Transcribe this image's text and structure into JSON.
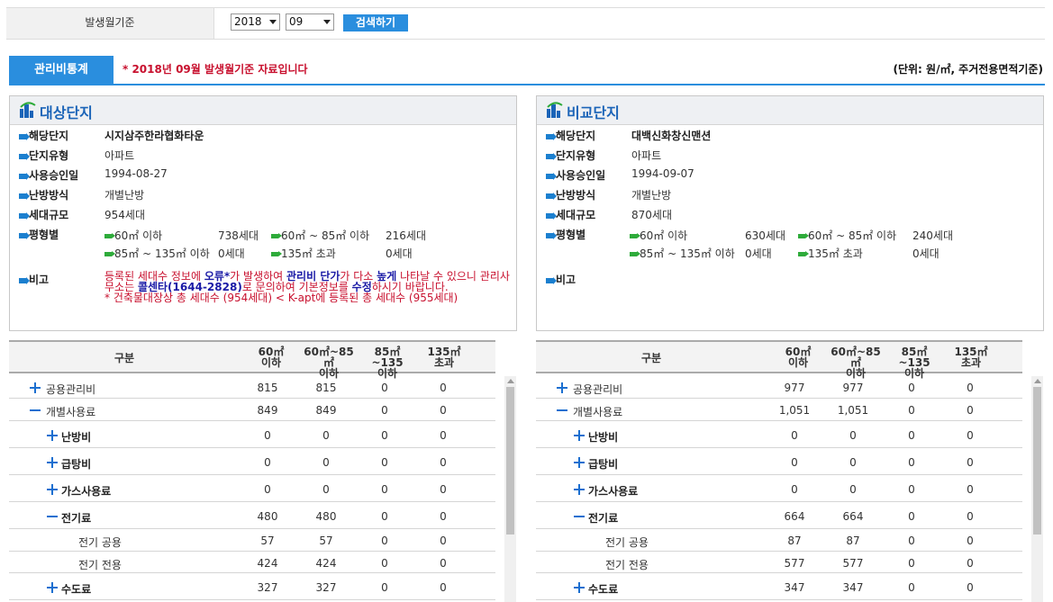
{
  "filter": {
    "label": "발생월기준",
    "year": "2018",
    "month": "09",
    "search_label": "검색하기"
  },
  "tab_label": "관리비통계",
  "notice": "* 2018년 09월 발생월기준 자료입니다",
  "unit": "(단위: 원/㎡, 주거전용면적기준)",
  "target": {
    "title": "대상단지",
    "labels": {
      "name": "해당단지",
      "type": "단지유형",
      "approval": "사용승인일",
      "heating": "난방방식",
      "households": "세대규모",
      "sizes": "평형별",
      "remarks": "비고"
    },
    "name": "시지삼주한라협화타운",
    "type": "아파트",
    "approval": "1994-08-27",
    "heating": "개별난방",
    "households": "954세대",
    "sizes": [
      {
        "label": "60㎡ 이하",
        "value": "738세대"
      },
      {
        "label": "60㎡ ~ 85㎡ 이하",
        "value": "216세대"
      },
      {
        "label": "85㎡ ~ 135㎡ 이하",
        "value": "0세대"
      },
      {
        "label": "135㎡ 초과",
        "value": "0세대"
      }
    ],
    "remarks": {
      "p1": "등록된 세대수 정보에 ",
      "p2": "오류*",
      "p3": "가 발생하여 ",
      "p4": "관리비 단가",
      "p5": "가 다소 ",
      "p6": "높게",
      "p7": " 나타날 수 있으니 관리사무소는 ",
      "p8": "콜센타(1644-2828)",
      "p9": "로 문의하여 기본정보를 ",
      "p10": "수정",
      "p11": "하시기 바랍니다.",
      "p12": "* 건축물대장상 총 세대수 (954세대) < K-apt에 등록된 총 세대수 (955세대)"
    }
  },
  "compare": {
    "title": "비교단지",
    "labels": {
      "name": "해당단지",
      "type": "단지유형",
      "approval": "사용승인일",
      "heating": "난방방식",
      "households": "세대규모",
      "sizes": "평형별",
      "remarks": "비고"
    },
    "name": "대백신화창신맨션",
    "type": "아파트",
    "approval": "1994-09-07",
    "heating": "개별난방",
    "households": "870세대",
    "sizes": [
      {
        "label": "60㎡ 이하",
        "value": "630세대"
      },
      {
        "label": "60㎡ ~ 85㎡ 이하",
        "value": "240세대"
      },
      {
        "label": "85㎡ ~ 135㎡ 이하",
        "value": "0세대"
      },
      {
        "label": "135㎡ 초과",
        "value": "0세대"
      }
    ]
  },
  "table_headers": {
    "category": "구분",
    "c1a": "60㎡",
    "c1b": "이하",
    "c2a": "60㎡~85㎡",
    "c2b": "이하",
    "c3a": "85㎡~135",
    "c3b": "이하",
    "c4a": "135㎡",
    "c4b": "초과"
  },
  "target_rows": [
    {
      "name": "공용관리비",
      "v": [
        "815",
        "815",
        "0",
        "0"
      ]
    },
    {
      "name": "개별사용료",
      "v": [
        "849",
        "849",
        "0",
        "0"
      ]
    },
    {
      "name": "난방비",
      "v": [
        "0",
        "0",
        "0",
        "0"
      ]
    },
    {
      "name": "급탕비",
      "v": [
        "0",
        "0",
        "0",
        "0"
      ]
    },
    {
      "name": "가스사용료",
      "v": [
        "0",
        "0",
        "0",
        "0"
      ]
    },
    {
      "name": "전기료",
      "v": [
        "480",
        "480",
        "0",
        "0"
      ]
    },
    {
      "name": "전기 공용",
      "v": [
        "57",
        "57",
        "0",
        "0"
      ]
    },
    {
      "name": "전기 전용",
      "v": [
        "424",
        "424",
        "0",
        "0"
      ]
    },
    {
      "name": "수도료",
      "v": [
        "327",
        "327",
        "0",
        "0"
      ]
    }
  ],
  "compare_rows": [
    {
      "name": "공용관리비",
      "v": [
        "977",
        "977",
        "0",
        "0"
      ]
    },
    {
      "name": "개별사용료",
      "v": [
        "1,051",
        "1,051",
        "0",
        "0"
      ]
    },
    {
      "name": "난방비",
      "v": [
        "0",
        "0",
        "0",
        "0"
      ]
    },
    {
      "name": "급탕비",
      "v": [
        "0",
        "0",
        "0",
        "0"
      ]
    },
    {
      "name": "가스사용료",
      "v": [
        "0",
        "0",
        "0",
        "0"
      ]
    },
    {
      "name": "전기료",
      "v": [
        "664",
        "664",
        "0",
        "0"
      ]
    },
    {
      "name": "전기 공용",
      "v": [
        "87",
        "87",
        "0",
        "0"
      ]
    },
    {
      "name": "전기 전용",
      "v": [
        "577",
        "577",
        "0",
        "0"
      ]
    },
    {
      "name": "수도료",
      "v": [
        "347",
        "347",
        "0",
        "0"
      ]
    }
  ]
}
